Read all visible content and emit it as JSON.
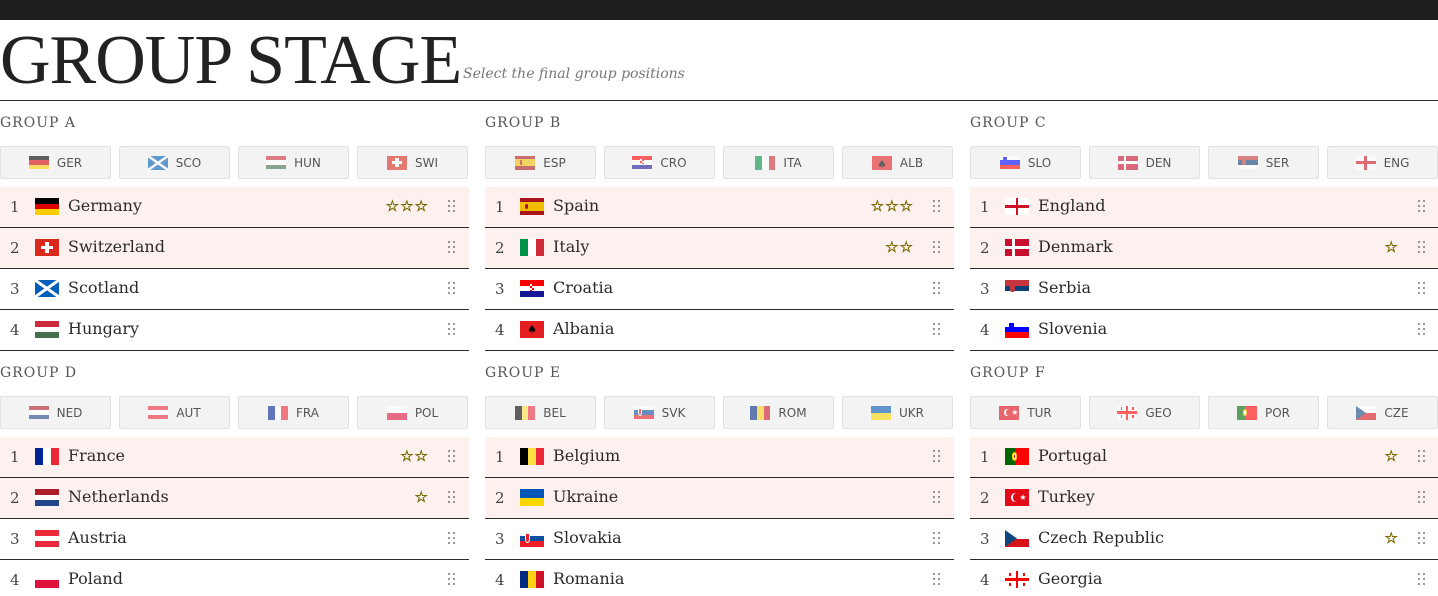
{
  "header": {
    "title": "GROUP STAGE",
    "subtitle": "Select the final group positions"
  },
  "groups": [
    {
      "title": "GROUP A",
      "chips": [
        {
          "code": "GER",
          "flag": "germany-flag"
        },
        {
          "code": "SCO",
          "flag": "scotland-flag"
        },
        {
          "code": "HUN",
          "flag": "hungary-flag"
        },
        {
          "code": "SWI",
          "flag": "switzerland-flag"
        }
      ],
      "rows": [
        {
          "pos": "1",
          "team": "Germany",
          "flag": "germany-flag",
          "stars": "☆☆☆"
        },
        {
          "pos": "2",
          "team": "Switzerland",
          "flag": "switzerland-flag",
          "stars": ""
        },
        {
          "pos": "3",
          "team": "Scotland",
          "flag": "scotland-flag",
          "stars": ""
        },
        {
          "pos": "4",
          "team": "Hungary",
          "flag": "hungary-flag",
          "stars": ""
        }
      ]
    },
    {
      "title": "GROUP B",
      "chips": [
        {
          "code": "ESP",
          "flag": "spain-flag"
        },
        {
          "code": "CRO",
          "flag": "croatia-flag"
        },
        {
          "code": "ITA",
          "flag": "italy-flag"
        },
        {
          "code": "ALB",
          "flag": "albania-flag"
        }
      ],
      "rows": [
        {
          "pos": "1",
          "team": "Spain",
          "flag": "spain-flag",
          "stars": "☆☆☆"
        },
        {
          "pos": "2",
          "team": "Italy",
          "flag": "italy-flag",
          "stars": "☆☆"
        },
        {
          "pos": "3",
          "team": "Croatia",
          "flag": "croatia-flag",
          "stars": ""
        },
        {
          "pos": "4",
          "team": "Albania",
          "flag": "albania-flag",
          "stars": ""
        }
      ]
    },
    {
      "title": "GROUP C",
      "chips": [
        {
          "code": "SLO",
          "flag": "slovenia-flag"
        },
        {
          "code": "DEN",
          "flag": "denmark-flag"
        },
        {
          "code": "SER",
          "flag": "serbia-flag"
        },
        {
          "code": "ENG",
          "flag": "england-flag"
        }
      ],
      "rows": [
        {
          "pos": "1",
          "team": "England",
          "flag": "england-flag",
          "stars": ""
        },
        {
          "pos": "2",
          "team": "Denmark",
          "flag": "denmark-flag",
          "stars": "☆"
        },
        {
          "pos": "3",
          "team": "Serbia",
          "flag": "serbia-flag",
          "stars": ""
        },
        {
          "pos": "4",
          "team": "Slovenia",
          "flag": "slovenia-flag",
          "stars": ""
        }
      ]
    },
    {
      "title": "GROUP D",
      "chips": [
        {
          "code": "NED",
          "flag": "netherlands-flag"
        },
        {
          "code": "AUT",
          "flag": "austria-flag"
        },
        {
          "code": "FRA",
          "flag": "france-flag"
        },
        {
          "code": "POL",
          "flag": "poland-flag"
        }
      ],
      "rows": [
        {
          "pos": "1",
          "team": "France",
          "flag": "france-flag",
          "stars": "☆☆"
        },
        {
          "pos": "2",
          "team": "Netherlands",
          "flag": "netherlands-flag",
          "stars": "☆"
        },
        {
          "pos": "3",
          "team": "Austria",
          "flag": "austria-flag",
          "stars": ""
        },
        {
          "pos": "4",
          "team": "Poland",
          "flag": "poland-flag",
          "stars": ""
        }
      ]
    },
    {
      "title": "GROUP E",
      "chips": [
        {
          "code": "BEL",
          "flag": "belgium-flag"
        },
        {
          "code": "SVK",
          "flag": "slovakia-flag"
        },
        {
          "code": "ROM",
          "flag": "romania-flag"
        },
        {
          "code": "UKR",
          "flag": "ukraine-flag"
        }
      ],
      "rows": [
        {
          "pos": "1",
          "team": "Belgium",
          "flag": "belgium-flag",
          "stars": ""
        },
        {
          "pos": "2",
          "team": "Ukraine",
          "flag": "ukraine-flag",
          "stars": ""
        },
        {
          "pos": "3",
          "team": "Slovakia",
          "flag": "slovakia-flag",
          "stars": ""
        },
        {
          "pos": "4",
          "team": "Romania",
          "flag": "romania-flag",
          "stars": ""
        }
      ]
    },
    {
      "title": "GROUP F",
      "chips": [
        {
          "code": "TUR",
          "flag": "turkey-flag"
        },
        {
          "code": "GEO",
          "flag": "georgia-flag"
        },
        {
          "code": "POR",
          "flag": "portugal-flag"
        },
        {
          "code": "CZE",
          "flag": "czech-republic-flag"
        }
      ],
      "rows": [
        {
          "pos": "1",
          "team": "Portugal",
          "flag": "portugal-flag",
          "stars": "☆"
        },
        {
          "pos": "2",
          "team": "Turkey",
          "flag": "turkey-flag",
          "stars": ""
        },
        {
          "pos": "3",
          "team": "Czech Republic",
          "flag": "czech-republic-flag",
          "stars": "☆"
        },
        {
          "pos": "4",
          "team": "Georgia",
          "flag": "georgia-flag",
          "stars": ""
        }
      ]
    }
  ],
  "colors": {
    "top_bar": "#1e1e1e",
    "qualified_row_bg": "#fcf1ef",
    "chip_bg": "#f3f3f3",
    "star": "#d8b800"
  }
}
